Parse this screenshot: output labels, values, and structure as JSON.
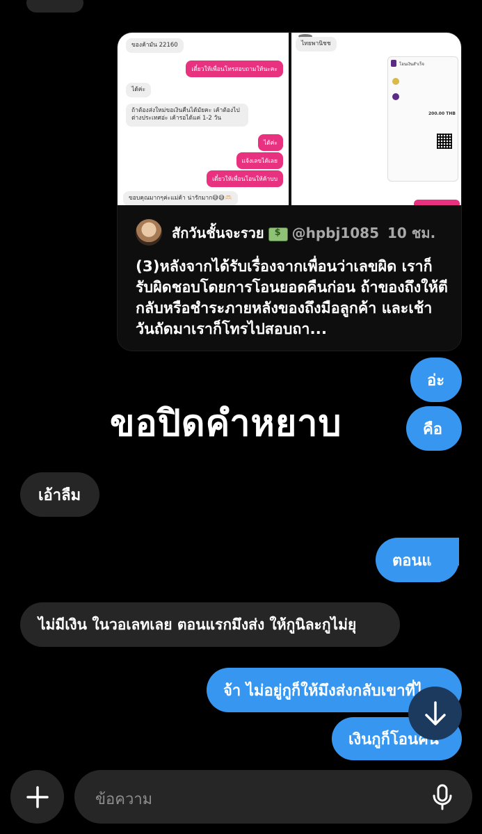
{
  "shared_post": {
    "left_screenshot": {
      "messages": [
        {
          "side": "in",
          "text": "ของค้ามัน 22160"
        },
        {
          "side": "out",
          "text": "เดี๋ยวให้เพื่อนโทรสอบถามให้นะคะ"
        },
        {
          "side": "in",
          "text": "ได้ค่ะ"
        },
        {
          "side": "in",
          "text": "ถ้าต้องส่งใหม่ขอเงินคืนได้มัยคะ เค้าต้องไปต่างประเทศอ่ะ เค้ารอได้แค่ 1-2 วัน"
        },
        {
          "side": "out",
          "text": "ได้ค่ะ"
        },
        {
          "side": "out",
          "text": "แจ้งเลขได้เลย"
        },
        {
          "side": "out",
          "text": "เดี๋ยวให้เพื่อนโอนให้ค้าบบ"
        },
        {
          "side": "in",
          "text": "ขอบคุณมากๆค่ะแม่ค้า น่ารักมาก😅😅🫶🏻"
        }
      ]
    },
    "right_screenshot": {
      "name": "ไทยพานิชช",
      "slip_title": "โอนเงินสำเร็จ",
      "amount": "200.00 THB"
    },
    "author_name": "สักวันชั้นจะรวย",
    "author_handle": "@hpbj1085",
    "time": "10 ชม.",
    "caption": "(3)หลังจากได้รับเรื่องจากเพื่อนว่าเลขผิด เราก็รับผิดชอบโดยการโอนยอดคืนก่อน ถ้าของถึงให้ตีกลับหรือชำระภายหลังของถึงมือลูกค้า และเช้าวันถัดมาเราก็โทรไปสอบถา..."
  },
  "overlay_text": "ขอปิดคำหยาบ",
  "messages": [
    {
      "id": "m1",
      "side": "out",
      "text": "อ่ะ"
    },
    {
      "id": "m2",
      "side": "out",
      "text": "คือ"
    },
    {
      "id": "m3",
      "side": "in",
      "text": "เอ้าลืม"
    },
    {
      "id": "m4",
      "side": "out",
      "text": "ตอนแ"
    },
    {
      "id": "m5",
      "side": "in",
      "text": "ไม่มีเงิน ในวอเลทเลย ตอนแรกมึงส่ง ให้กูนิละกูไม่ยุ"
    },
    {
      "id": "m6",
      "side": "out",
      "text": "จ้า ไม่อยู่กูก็ให้มึงส่งกลับเขาที่ไ"
    },
    {
      "id": "m7",
      "side": "out",
      "text": "เงินกูก็โอนคืน"
    }
  ],
  "composer": {
    "placeholder": "ข้อความ"
  },
  "icons": {
    "scroll_down": "arrow-down-icon",
    "add": "plus-icon",
    "mic": "microphone-icon"
  },
  "colors": {
    "outgoing_bubble": "#3797f0",
    "incoming_bubble": "#262626",
    "background": "#000000"
  }
}
